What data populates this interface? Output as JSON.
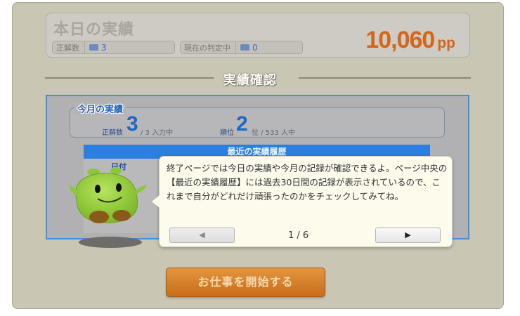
{
  "summary": {
    "title": "本日の実績",
    "correct_label": "正解数",
    "correct_value": "3",
    "judging_label": "現在の判定中",
    "judging_value": "0",
    "points_value": "10,060",
    "points_unit": "pp"
  },
  "section": {
    "title": "実績確認"
  },
  "month": {
    "label": "今月の実績",
    "correct_label": "正解数",
    "correct_value": "3",
    "correct_sub": "/ 3 入力中",
    "rank_label": "順位",
    "rank_value": "2",
    "rank_sub": "位 / 533 人中"
  },
  "history": {
    "title": "最近の実績履歴",
    "date_header": "日付"
  },
  "tutorial": {
    "text": "終了ページでは今日の実績や今月の記録が確認できるよ。ページ中央の【最近の実績履歴】には過去30日間の記録が表示されているので、これまで自分がどれだけ頑張ったのかをチェックしてみてね。",
    "prev_icon": "◀",
    "next_icon": "▶",
    "page_indicator": "1 / 6"
  },
  "start_button": {
    "label": "お仕事を開始する"
  },
  "colors": {
    "accent_blue": "#2b7fe0",
    "points_orange": "#d3661a",
    "button_orange": "#d98530"
  }
}
